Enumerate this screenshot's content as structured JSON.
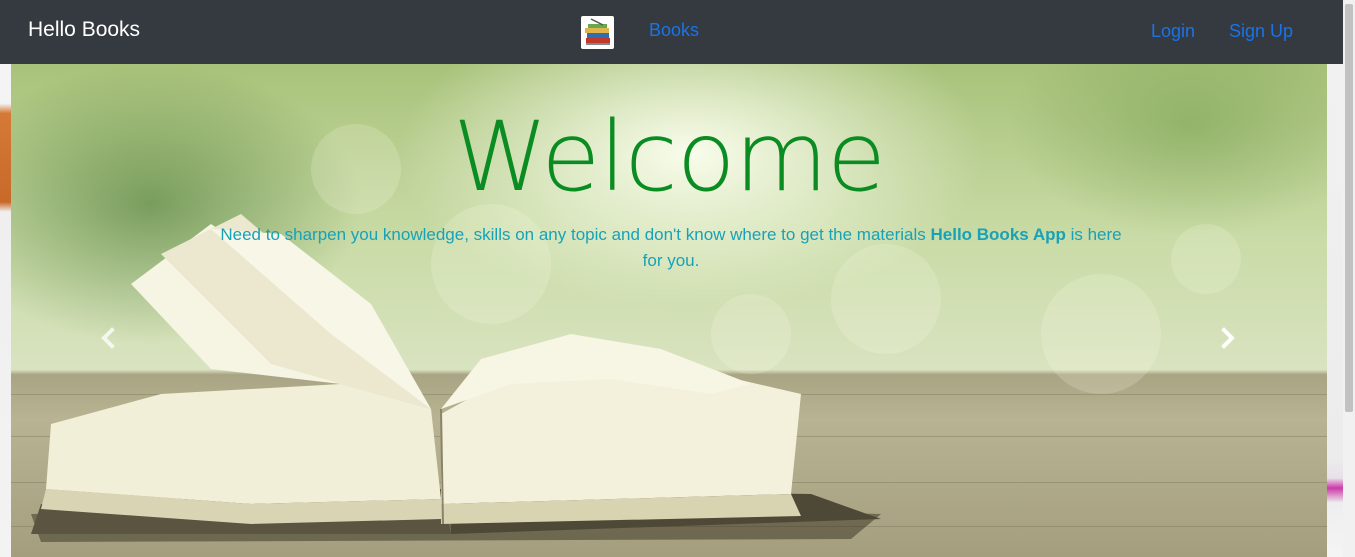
{
  "navbar": {
    "brand": "Hello Books",
    "links": {
      "books": "Books",
      "login": "Login",
      "sign_up": "Sign Up"
    },
    "logo_icon": "books-stack-icon"
  },
  "hero": {
    "heading": "Welcome",
    "intro_text": "Need to sharpen you knowledge, skills on any topic and don't know where to get the materials ",
    "intro_app": "Hello Books App",
    "intro_suffix": " is here for you."
  },
  "carousel": {
    "prev_icon": "chevron-left-icon",
    "next_icon": "chevron-right-icon"
  },
  "colors": {
    "navbar_bg": "#343a40",
    "brand_text": "#ffffff",
    "link": "#1a73e8",
    "heading": "#0a8c22",
    "intro": "#17a2b8"
  }
}
